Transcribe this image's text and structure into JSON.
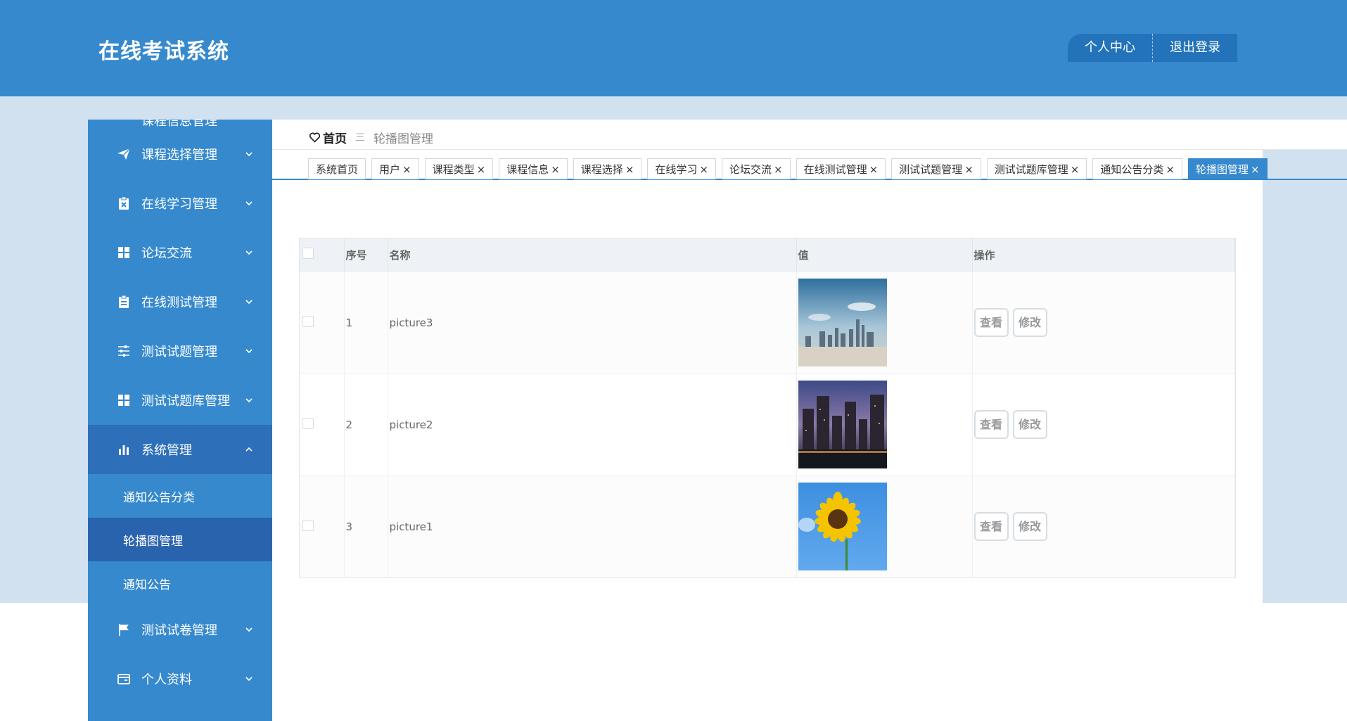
{
  "header": {
    "title": "在线考试系统",
    "profile_label": "个人中心",
    "logout_label": "退出登录"
  },
  "sidebar": {
    "partial_item": {
      "label": "课程信息管理",
      "icon": "list-icon"
    },
    "items": [
      {
        "label": "课程选择管理",
        "icon": "paper-plane-icon"
      },
      {
        "label": "在线学习管理",
        "icon": "clipboard-x-icon"
      },
      {
        "label": "论坛交流",
        "icon": "grid-icon"
      },
      {
        "label": "在线测试管理",
        "icon": "clipboard-icon"
      },
      {
        "label": "测试试题管理",
        "icon": "sliders-icon"
      },
      {
        "label": "测试试题库管理",
        "icon": "grid-icon"
      },
      {
        "label": "系统管理",
        "icon": "bar-chart-icon"
      }
    ],
    "sub_items": [
      {
        "label": "通知公告分类"
      },
      {
        "label": "轮播图管理"
      },
      {
        "label": "通知公告"
      }
    ],
    "items_after": [
      {
        "label": "测试试卷管理",
        "icon": "flag-icon"
      },
      {
        "label": "个人资料",
        "icon": "wallet-icon"
      }
    ]
  },
  "breadcrumb": {
    "home": "首页",
    "separator": "三",
    "current": "轮播图管理"
  },
  "tabs": [
    {
      "label": "系统首页",
      "closable": false
    },
    {
      "label": "用户",
      "closable": true
    },
    {
      "label": "课程类型",
      "closable": true
    },
    {
      "label": "课程信息",
      "closable": true
    },
    {
      "label": "课程选择",
      "closable": true
    },
    {
      "label": "在线学习",
      "closable": true
    },
    {
      "label": "论坛交流",
      "closable": true
    },
    {
      "label": "在线测试管理",
      "closable": true
    },
    {
      "label": "测试试题管理",
      "closable": true
    },
    {
      "label": "测试试题库管理",
      "closable": true
    },
    {
      "label": "通知公告分类",
      "closable": true
    },
    {
      "label": "轮播图管理",
      "closable": true,
      "active": true
    }
  ],
  "tab_close_glyph": "×",
  "table": {
    "headers": {
      "index": "序号",
      "name": "名称",
      "value": "值",
      "actions": "操作"
    },
    "rows": [
      {
        "index": "1",
        "name": "picture3",
        "image": "city-skyline-image"
      },
      {
        "index": "2",
        "name": "picture2",
        "image": "city-night-image"
      },
      {
        "index": "3",
        "name": "picture1",
        "image": "sunflower-image"
      }
    ],
    "view_label": "查看",
    "edit_label": "修改"
  },
  "colors": {
    "primary": "#3689cd",
    "active_sidebar": "#2d6fb8",
    "band": "#d2e1f0"
  }
}
